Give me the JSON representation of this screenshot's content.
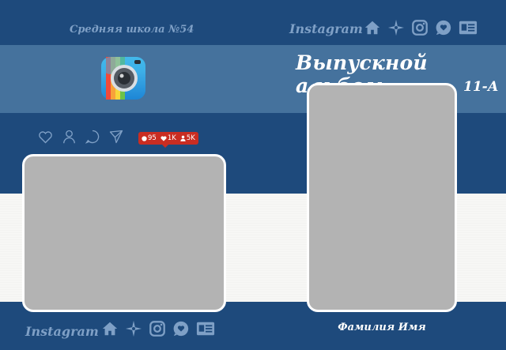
{
  "header": {
    "school": "Средняя школа №54",
    "instagram_label": "Instagram"
  },
  "title": {
    "main": "Выпускной альбом",
    "class": "11-А"
  },
  "badge": {
    "comments": "95",
    "likes": "1K",
    "followers": "5K"
  },
  "footer": {
    "instagram_label": "Instagram",
    "person_name": "Фамилия Имя"
  },
  "icons": {
    "top": [
      "home-icon",
      "explore-icon",
      "instagram-icon",
      "chat-heart-icon",
      "profile-card-icon"
    ],
    "bottom": [
      "home-icon",
      "explore-icon",
      "instagram-icon",
      "chat-heart-icon",
      "profile-card-icon"
    ],
    "social": [
      "heart-icon",
      "user-icon",
      "comment-icon",
      "send-icon"
    ]
  },
  "colors": {
    "background": "#1e4a7c",
    "band": "#45729d",
    "badge": "#c92d22",
    "photo_placeholder": "#b3b3b3"
  }
}
